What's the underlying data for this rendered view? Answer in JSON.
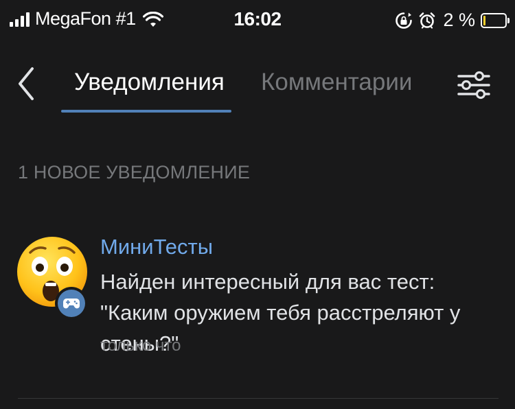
{
  "status_bar": {
    "carrier": "MegaFon #1",
    "time": "16:02",
    "battery_percent": "2 %",
    "battery_level": 0.02
  },
  "header": {
    "tabs": [
      {
        "label": "Уведомления",
        "active": true
      },
      {
        "label": "Комментарии",
        "active": false
      }
    ]
  },
  "section": {
    "title": "1 НОВОЕ УВЕДОМЛЕНИЕ"
  },
  "notifications": [
    {
      "title": "МиниТесты",
      "text": "Найден интересный для вас тест: \"Каким оружием тебя расстреляют у стены?\"",
      "time": "только что",
      "avatar_icon": "surprised-face-icon",
      "badge_icon": "gamepad-icon"
    }
  ],
  "colors": {
    "background": "#19191a",
    "accent": "#5181b8",
    "link": "#71aaeb",
    "secondary_text": "#76787b",
    "primary_text": "#e1e3e6"
  }
}
